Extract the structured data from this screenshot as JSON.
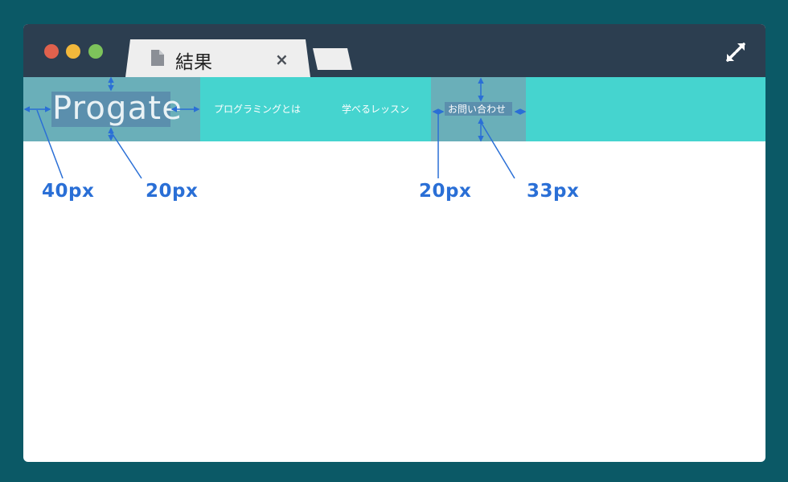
{
  "window_controls": [
    "close",
    "minimize",
    "maximize"
  ],
  "tab": {
    "title": "結果",
    "icon": "document-icon",
    "close_label": "×"
  },
  "header": {
    "logo": "Progate",
    "nav": [
      "プログラミングとは",
      "学べるレッスン",
      "お問い合わせ"
    ]
  },
  "annotations": {
    "a": "40px",
    "b": "20px",
    "c": "20px",
    "d": "33px"
  },
  "colors": {
    "background": "#0b5966",
    "titlebar": "#2c3e50",
    "header": "#45d4cf",
    "highlight": "#6aafb9",
    "highlight_inner": "#5b8fad",
    "annotation": "#2a6fd6"
  }
}
